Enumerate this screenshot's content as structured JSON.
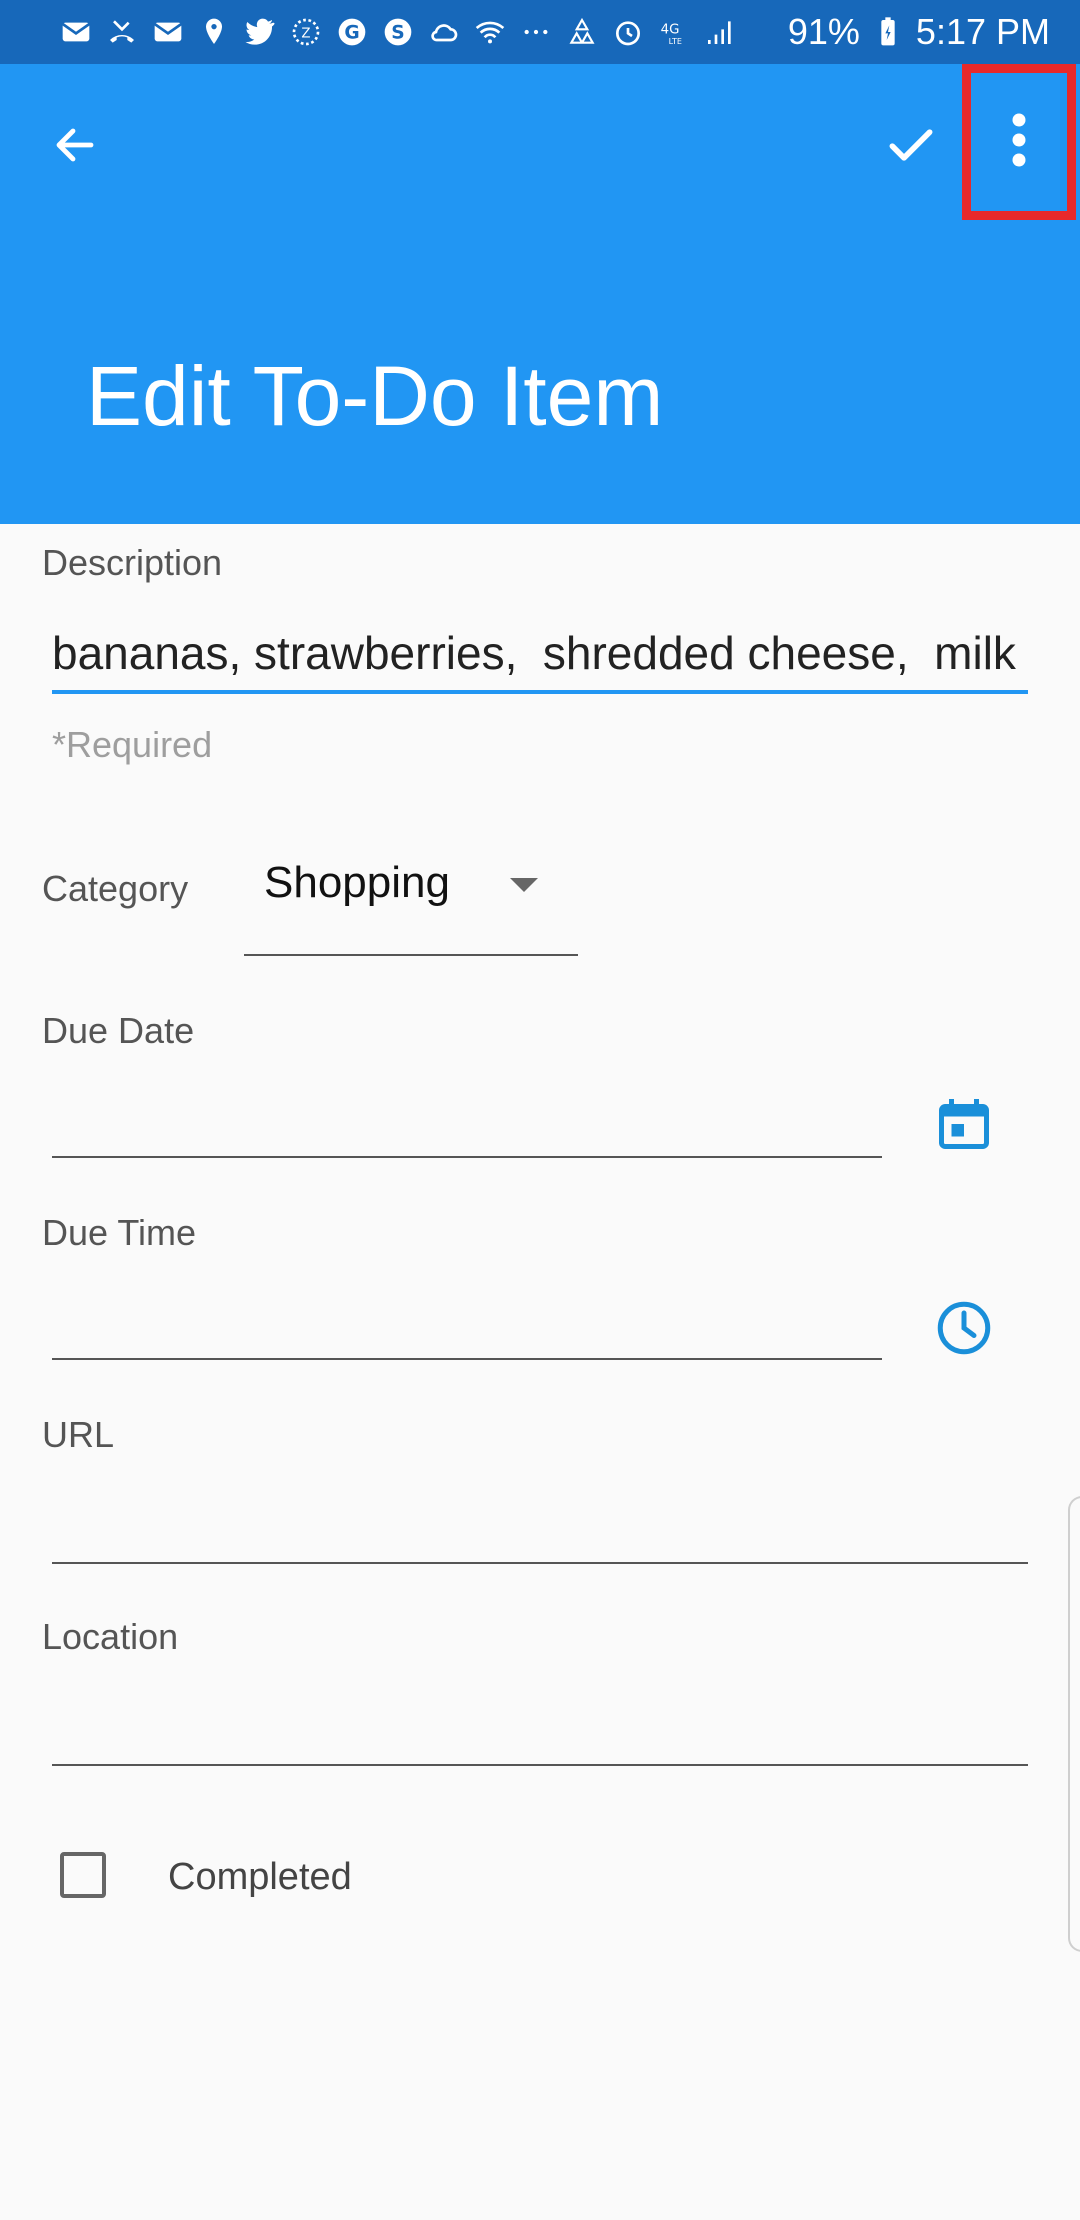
{
  "status_bar": {
    "battery": "91%",
    "time": "5:17 PM",
    "icons": [
      "mail-icon",
      "missed-call-icon",
      "mail-icon",
      "location-icon",
      "twitter-icon",
      "badge-icon",
      "g-icon",
      "s-icon",
      "cloud-icon",
      "wifi-icon",
      "more-dots-icon",
      "recycle-icon",
      "alarm-icon",
      "4g-lte-icon",
      "signal-icon"
    ]
  },
  "app_bar": {
    "title": "Edit To-Do Item",
    "color": "#2196f3",
    "actions": [
      "back-arrow-icon",
      "check-icon",
      "more-vert-icon"
    ]
  },
  "form": {
    "description": {
      "label": "Description",
      "value": "bananas, strawberries,  shredded cheese,  milk",
      "helper": "*Required"
    },
    "category": {
      "label": "Category",
      "value": "Shopping"
    },
    "due_date": {
      "label": "Due Date",
      "value": "",
      "icon": "calendar-icon"
    },
    "due_time": {
      "label": "Due Time",
      "value": "",
      "icon": "clock-icon"
    },
    "url": {
      "label": "URL",
      "value": ""
    },
    "location": {
      "label": "Location",
      "value": ""
    },
    "completed": {
      "label": "Completed",
      "checked": false
    }
  },
  "accent_color": "#1a8fd9",
  "highlight_color": "#e8292b"
}
